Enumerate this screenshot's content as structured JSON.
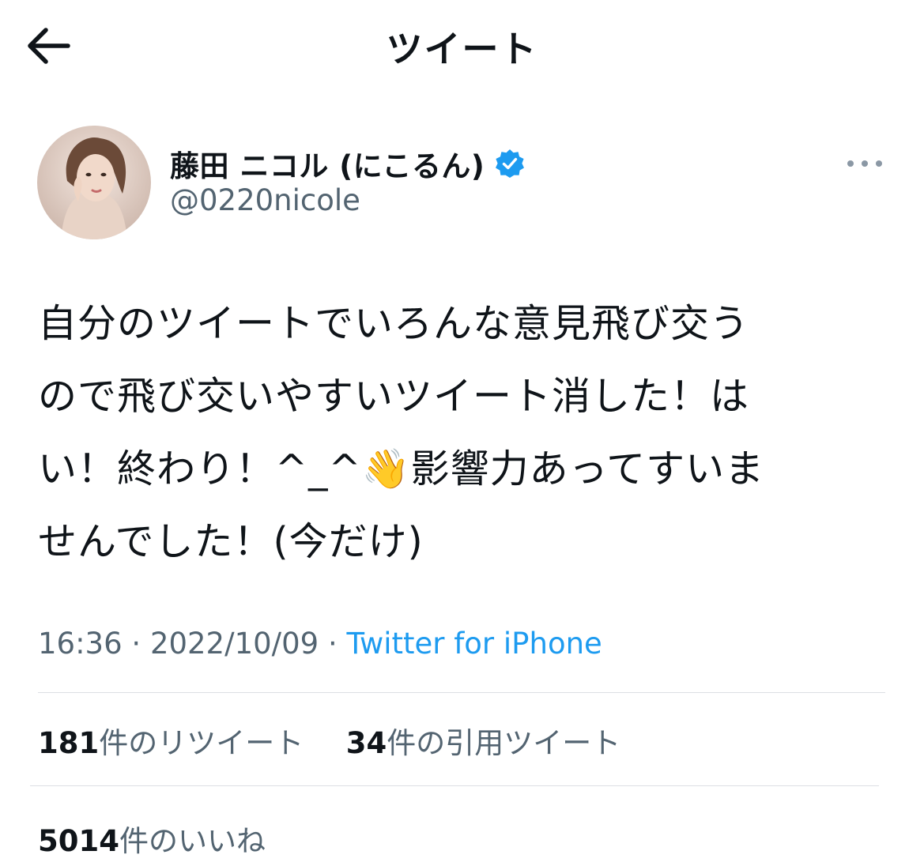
{
  "header": {
    "title": "ツイート",
    "back_icon": "arrow-left-icon"
  },
  "user": {
    "display_name": "藤田 ニコル (にこるん)",
    "handle": "@0220nicole",
    "verified_icon": "verified-badge-icon",
    "verified_color": "#1d9bf0"
  },
  "more_icon": "more-dots-icon",
  "tweet": {
    "text": "自分のツイートでいろんな意見飛び交う\nので飛び交いやすいツイート消した！は\nい！終わり！^_^👋影響力あってすいま\nせんでした！(今だけ)"
  },
  "meta": {
    "time": "16:36",
    "sep1": "·",
    "date": "2022/10/09",
    "sep2": "·",
    "source": "Twitter for iPhone"
  },
  "stats": {
    "retweets_count": "181",
    "retweets_label": "件のリツイート",
    "quotes_count": "34",
    "quotes_label": "件の引用ツイート",
    "likes_count": "5014",
    "likes_label": "件のいいね"
  },
  "colors": {
    "accent": "#1d9bf0",
    "text": "#0f1419",
    "secondary": "#536471"
  }
}
